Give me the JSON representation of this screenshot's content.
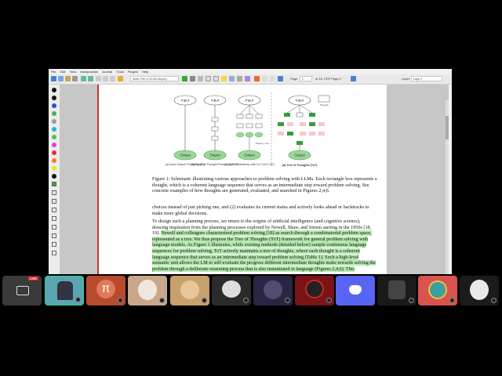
{
  "window": {
    "menu": [
      "File",
      "Edit",
      "View",
      "Manipulation",
      "Journal",
      "Tools",
      "Plugins",
      "Help"
    ],
    "toolbar": {
      "pen_field": "Arbitr. Pen (1.00 f04 Moyen)",
      "page_label": "Page",
      "page_value": "2",
      "page_total": "of 15, PDF Page 2",
      "layer_label": "Layer:",
      "layer_value": "Layer 1"
    }
  },
  "figure": {
    "input_label": "Input",
    "output_label": "Output",
    "thought_legend": "Thought",
    "sub_a": "(a) Input-Output Prompting (IO)",
    "sub_b": "(b) Chain of Thought Prompting (CoT)",
    "sub_c": "(c) Self Consistency with CoT (CoT-SC)",
    "sub_d": "(d) Tree of Thoughts (ToT)",
    "majority_vote": "Majority vote"
  },
  "document": {
    "caption": "Figure 1: Schematic illustrating various approaches to problem solving with LLMs. Each rectangle box represents a thought, which is a coherent language sequence that serves as an intermediate step toward problem solving. See concrete examples of how thoughts are generated, evaluated, and searched in Figures 2,4,6.",
    "para1": "choices instead of just picking one, and (2) evaluates its current status and actively looks ahead or backtracks to make more global decisions.",
    "para2_plain": "To design such a planning process, we return to the origins of artificial intelligence (and cognitive science), drawing inspiration from the planning processes explored by Newell, Shaw, and Simon starting in the 1950s [18, 19].",
    "para2_hl": "Newell and colleagues characterized problem solving [18] as search through a combinatorial problem space, represented as a tree. We thus propose the Tree of Thoughts (ToT) framework for general problem solving with language models. As Figure 1 illustrates, while existing methods (detailed below) sample continuous language sequences for problem solving, ToT actively maintains a tree of thoughts, where each thought is a coherent language sequence that serves as an intermediate step toward problem solving (Table 1). Such a high-level semantic unit allows the LM to self-evaluate the progress different intermediate thoughts make towards solving the problem through a deliberate reasoning process that is also instantiated in language (Figures 2,4,6). This"
  },
  "dock": {
    "live_badge": "LIVE",
    "tiles": [
      "camera",
      "shovel-knight",
      "pi",
      "dog",
      "shiba",
      "bird",
      "cat-dark",
      "dark-red",
      "discord",
      "warrior",
      "colorful",
      "masked-face"
    ]
  },
  "colors": {
    "highlight": "#b6e8b0",
    "ref_green": "#1a9a1a",
    "ref_red": "#d22222",
    "page_border": "#c0392b",
    "discord": "#5865f2"
  }
}
